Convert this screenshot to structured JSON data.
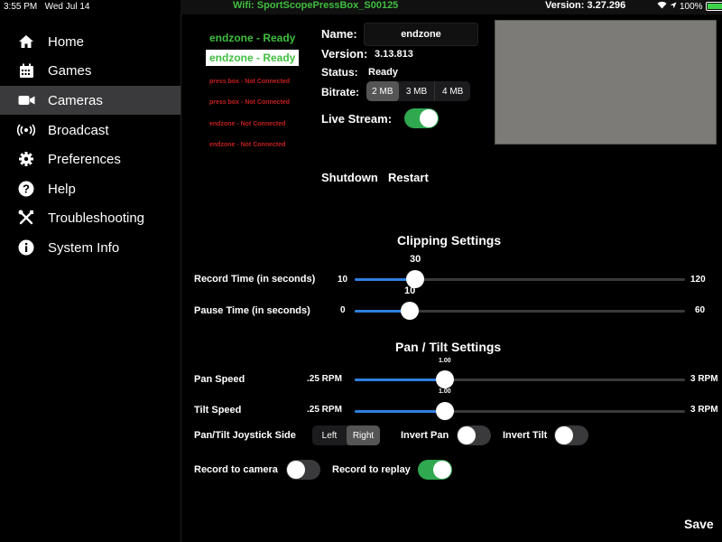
{
  "statusbar": {
    "time": "3:55 PM",
    "date": "Wed Jul 14",
    "wifi": "Wifi: SportScopePressBox_S00125",
    "version": "Version: 3.27.296",
    "battery": "100%"
  },
  "sidebar": {
    "items": [
      {
        "label": "Home",
        "icon": "home-icon"
      },
      {
        "label": "Games",
        "icon": "calendar-icon"
      },
      {
        "label": "Cameras",
        "icon": "camera-icon"
      },
      {
        "label": "Broadcast",
        "icon": "broadcast-icon"
      },
      {
        "label": "Preferences",
        "icon": "gear-icon"
      },
      {
        "label": "Help",
        "icon": "help-icon"
      },
      {
        "label": "Troubleshooting",
        "icon": "tools-icon"
      },
      {
        "label": "System Info",
        "icon": "info-icon"
      }
    ],
    "active": "Cameras"
  },
  "cameras": [
    {
      "label": "endzone - Ready",
      "state": "ready"
    },
    {
      "label": "endzone - Ready",
      "state": "selected"
    },
    {
      "label": "press box - Not Connected",
      "state": "not-connected"
    },
    {
      "label": "press box - Not Connected",
      "state": "not-connected"
    },
    {
      "label": "endzone - Not Connected",
      "state": "not-connected"
    },
    {
      "label": "endzone - Not Connected",
      "state": "not-connected"
    }
  ],
  "details": {
    "name_label": "Name:",
    "name_value": "endzone",
    "version_label": "Version:",
    "version_value": "3.13.813",
    "status_label": "Status:",
    "status_value": "Ready",
    "bitrate_label": "Bitrate:",
    "bitrate_options": [
      "2 MB",
      "3 MB",
      "4 MB"
    ],
    "bitrate_selected": "2 MB",
    "live_stream_label": "Live Stream:",
    "live_stream_on": true,
    "shutdown_label": "Shutdown",
    "restart_label": "Restart"
  },
  "clipping": {
    "title": "Clipping Settings",
    "record": {
      "label": "Record Time (in seconds)",
      "min": "10",
      "max": "120",
      "value": "30",
      "fraction": 0.1818
    },
    "pause": {
      "label": "Pause Time (in seconds)",
      "min": "0",
      "max": "60",
      "value": "10",
      "fraction": 0.1667
    }
  },
  "pantilt": {
    "title": "Pan / Tilt Settings",
    "pan": {
      "label": "Pan Speed",
      "min": ".25 RPM",
      "max": "3 RPM",
      "value": "1.00",
      "fraction": 0.2727
    },
    "tilt": {
      "label": "Tilt Speed",
      "min": ".25 RPM",
      "max": "3 RPM",
      "value": "1.00",
      "fraction": 0.2727
    },
    "joystick_label": "Pan/Tilt Joystick Side",
    "joystick_options": [
      "Left",
      "Right"
    ],
    "joystick_selected": "Right",
    "invert_pan_label": "Invert Pan",
    "invert_pan_on": false,
    "invert_tilt_label": "Invert Tilt",
    "invert_tilt_on": false,
    "record_camera_label": "Record to camera",
    "record_camera_on": false,
    "record_replay_label": "Record to replay",
    "record_replay_on": true
  },
  "save_label": "Save"
}
